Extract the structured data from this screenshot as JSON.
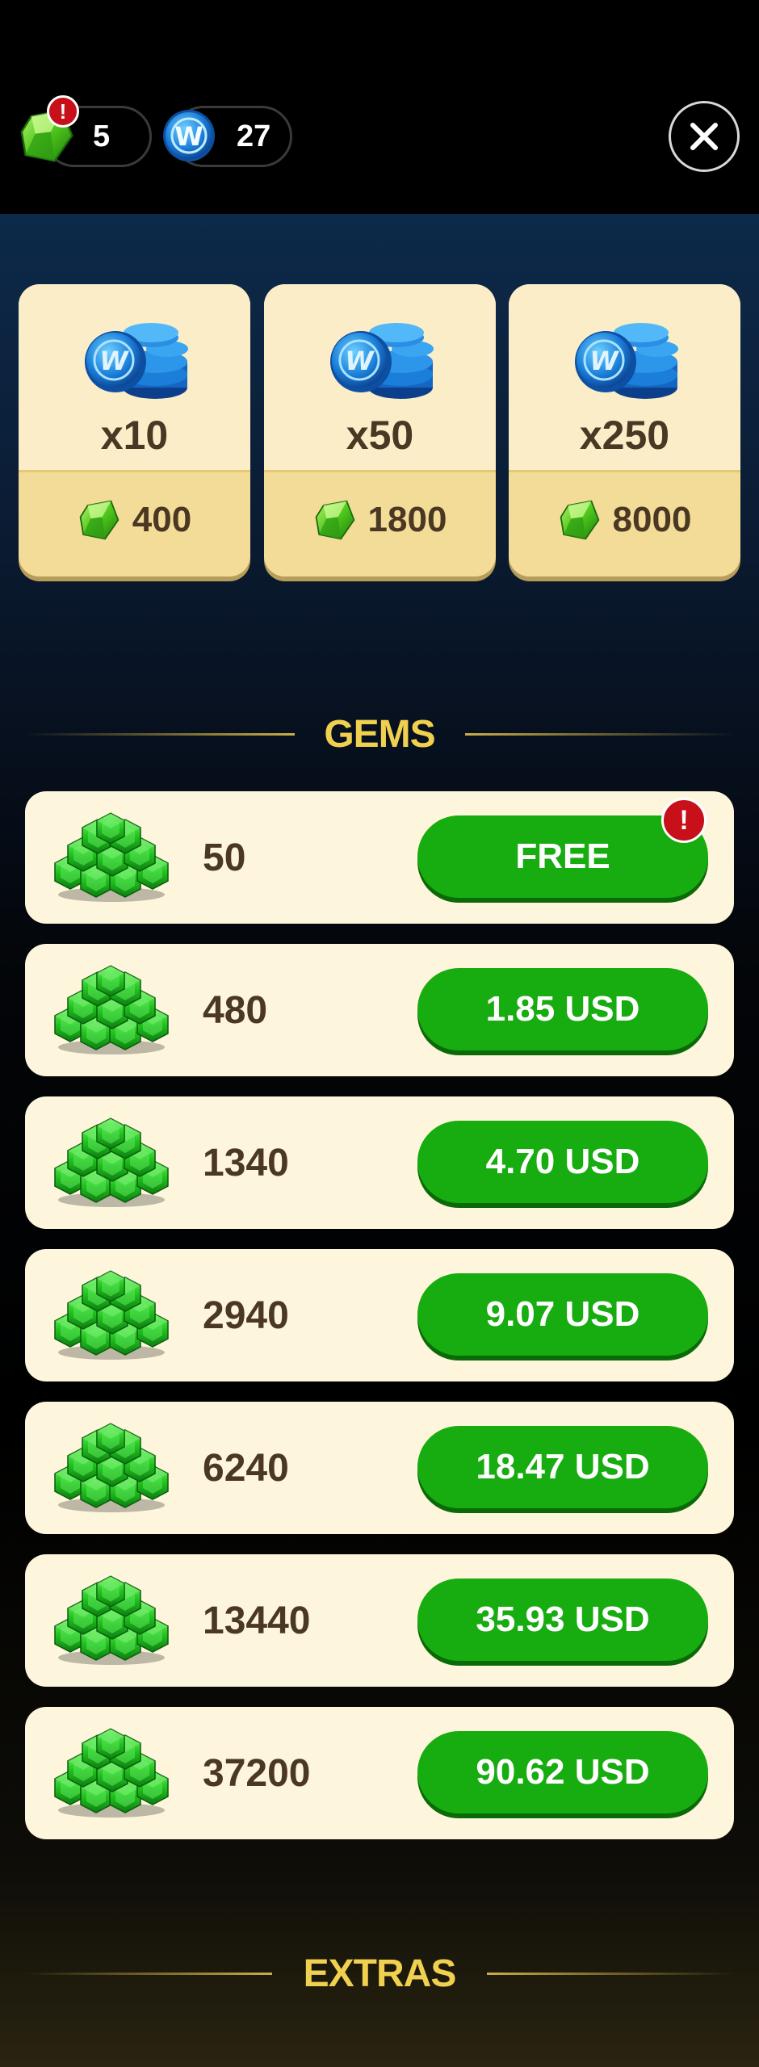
{
  "header": {
    "gem_balance": "5",
    "w_coin_balance": "27",
    "gem_badge": "!",
    "close_symbol": "✕"
  },
  "bundles": [
    {
      "quantity": "x10",
      "price": "400"
    },
    {
      "quantity": "x50",
      "price": "1800"
    },
    {
      "quantity": "x250",
      "price": "8000"
    }
  ],
  "gems_section": {
    "title": "GEMS",
    "offers": [
      {
        "amount": "50",
        "button": "FREE",
        "badge": "!"
      },
      {
        "amount": "480",
        "button": "1.85 USD"
      },
      {
        "amount": "1340",
        "button": "4.70 USD"
      },
      {
        "amount": "2940",
        "button": "9.07 USD"
      },
      {
        "amount": "6240",
        "button": "18.47 USD"
      },
      {
        "amount": "13440",
        "button": "35.93 USD"
      },
      {
        "amount": "37200",
        "button": "90.62 USD"
      }
    ]
  },
  "extras_section": {
    "title": "EXTRAS"
  },
  "colors": {
    "buy_button": "#17ac0f",
    "section_title": "#f0d04f",
    "card_cream": "#fdf5dc",
    "badge_red": "#c8101a"
  },
  "icons": [
    "gem-icon",
    "w-coin-icon",
    "close-icon",
    "coin-stack-icon",
    "gem-pile-icon"
  ]
}
